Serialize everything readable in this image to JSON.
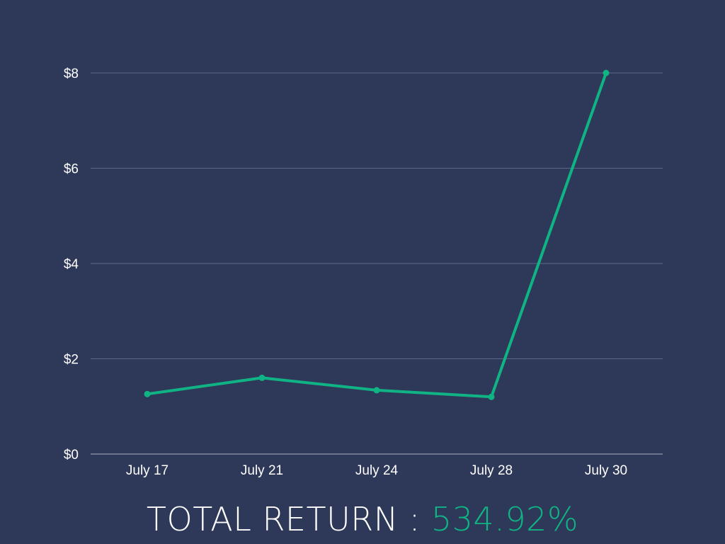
{
  "colors": {
    "background": "#2e3858",
    "line": "#10b384",
    "text": "#ffffff",
    "grid": "#5d6887"
  },
  "summary": {
    "label": "TOTAL RETURN : ",
    "value": "534.92%"
  },
  "chart_data": {
    "type": "line",
    "title": "",
    "xlabel": "",
    "ylabel": "",
    "categories": [
      "July 17",
      "July 21",
      "July 24",
      "July 28",
      "July 30"
    ],
    "series": [
      {
        "values": [
          1.26,
          1.6,
          1.34,
          1.2,
          8.0
        ]
      }
    ],
    "ylim": [
      0,
      8
    ],
    "y_ticks": [
      0,
      2,
      4,
      6,
      8
    ],
    "y_tick_labels": [
      "$0",
      "$2",
      "$4",
      "$6",
      "$8"
    ],
    "grid": true,
    "legend": "none"
  }
}
